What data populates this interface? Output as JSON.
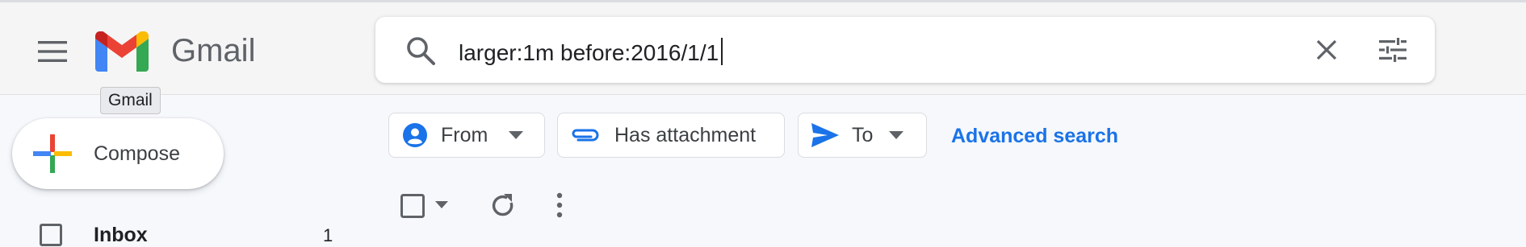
{
  "app": {
    "brand": "Gmail",
    "tooltip": "Gmail"
  },
  "icons": {
    "menu": "hamburger-menu-icon",
    "logo": "gmail-logo",
    "search": "search-icon",
    "clear": "close-icon",
    "options": "tune-icon"
  },
  "search": {
    "value": "larger:1m before:2016/1/1"
  },
  "compose": {
    "label": "Compose"
  },
  "filters": {
    "from_label": "From",
    "attachment_label": "Has attachment",
    "to_label": "To",
    "advanced_label": "Advanced search"
  },
  "sidebar": {
    "items": [
      {
        "label": "Inbox",
        "count": "1"
      }
    ]
  },
  "colors": {
    "accent": "#1a73e8",
    "gmail_red": "#ea4335",
    "gmail_blue": "#4285f4",
    "gmail_green": "#34a853",
    "gmail_yellow": "#fbbc04"
  }
}
